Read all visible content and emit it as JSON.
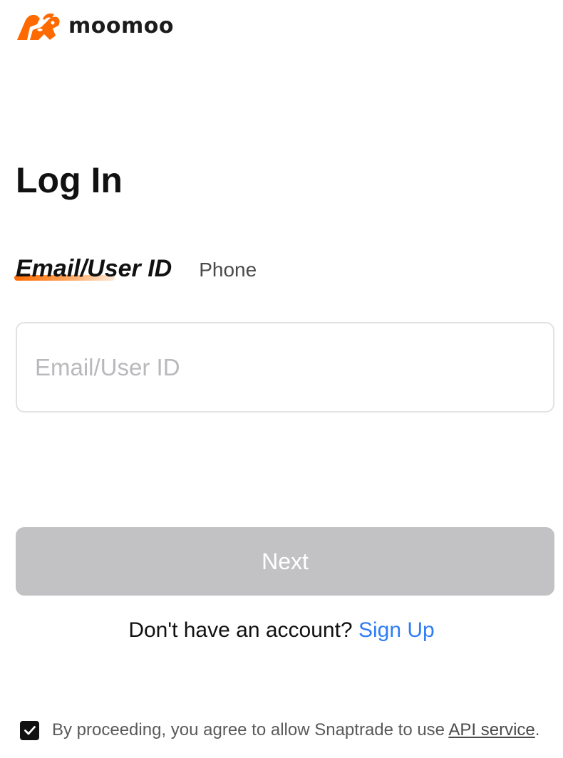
{
  "brand": {
    "name": "moomoo",
    "logo_icon": "moomoo-bull-logo",
    "logo_color": "#ff6a00"
  },
  "login": {
    "title": "Log In",
    "tabs": [
      {
        "label": "Email/User ID",
        "active": true
      },
      {
        "label": "Phone",
        "active": false
      }
    ],
    "email_field": {
      "value": "",
      "placeholder": "Email/User ID"
    },
    "next_button": {
      "label": "Next",
      "disabled": true
    },
    "signup": {
      "prompt": "Don't have an account?",
      "link_label": "Sign Up",
      "link_color": "#2f7df6"
    },
    "consent": {
      "checked": true,
      "text_before": "By proceeding, you agree to allow Snaptrade to use",
      "link_label": "API service",
      "text_after": "."
    }
  },
  "colors": {
    "accent_orange": "#ff6a00",
    "button_disabled": "#c2c2c4",
    "link_blue": "#2f7df6"
  }
}
